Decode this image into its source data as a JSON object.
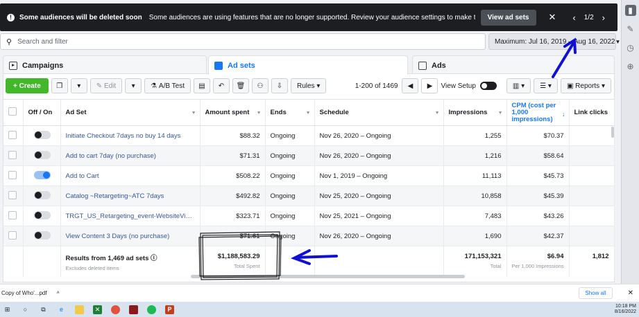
{
  "banner": {
    "title": "Some audiences will be deleted soon",
    "message": "Some audiences are using features that are no longer supported. Review your audience settings to make the necessary changes.",
    "view_button": "View ad sets",
    "pager": "1/2"
  },
  "search": {
    "placeholder": "Search and filter"
  },
  "date_range": "Maximum: Jul 16, 2019 – Aug 16, 2022",
  "tabs": [
    {
      "label": "Campaigns"
    },
    {
      "label": "Ad sets"
    },
    {
      "label": "Ads"
    }
  ],
  "toolbar": {
    "create": "Create",
    "edit": "Edit",
    "ab_test": "A/B Test",
    "rules": "Rules",
    "page_range": "1-200 of 1469",
    "view_setup": "View Setup",
    "reports": "Reports"
  },
  "columns": {
    "off_on": "Off / On",
    "ad_set": "Ad Set",
    "amount_spent": "Amount spent",
    "ends": "Ends",
    "schedule": "Schedule",
    "impressions": "Impressions",
    "cpm": "CPM (cost per 1,000 impressions)",
    "link_clicks": "Link clicks"
  },
  "rows": [
    {
      "name": "Initiate Checkout 7days no buy 14 days",
      "on": false,
      "spent": "$88.32",
      "ends": "Ongoing",
      "schedule": "Nov 26, 2020 – Ongoing",
      "impressions": "1,255",
      "cpm": "$70.37"
    },
    {
      "name": "Add to cart 7day (no purchase)",
      "on": false,
      "spent": "$71.31",
      "ends": "Ongoing",
      "schedule": "Nov 26, 2020 – Ongoing",
      "impressions": "1,216",
      "cpm": "$58.64"
    },
    {
      "name": "Add to Cart",
      "on": true,
      "spent": "$508.22",
      "ends": "Ongoing",
      "schedule": "Nov 1, 2019 – Ongoing",
      "impressions": "11,113",
      "cpm": "$45.73"
    },
    {
      "name": "Catalog ~Retargeting~ATC 7days",
      "on": false,
      "spent": "$492.82",
      "ends": "Ongoing",
      "schedule": "Nov 25, 2020 – Ongoing",
      "impressions": "10,858",
      "cpm": "$45.39"
    },
    {
      "name": "TRGT_US_Retargeting_event-WebsiteVisitors…",
      "on": false,
      "spent": "$323.71",
      "ends": "Ongoing",
      "schedule": "Nov 25, 2021 – Ongoing",
      "impressions": "7,483",
      "cpm": "$43.26"
    },
    {
      "name": "View Content 3 Days (no purchase)",
      "on": false,
      "spent": "$71.61",
      "ends": "Ongoing",
      "schedule": "Nov 26, 2020 – Ongoing",
      "impressions": "1,690",
      "cpm": "$42.37"
    }
  ],
  "totals": {
    "label": "Results from 1,469 ad sets",
    "sublabel": "Excludes deleted items",
    "spent": "$1,188,583.29",
    "spent_sub": "Total Spent",
    "impressions": "171,153,321",
    "impressions_sub": "Total",
    "cpm": "$6.94",
    "cpm_sub": "Per 1,000 Impressions",
    "link_clicks": "1,812"
  },
  "downloads": {
    "file": "Copy of Who'...pdf",
    "show_all": "Show all"
  },
  "taskbar": {
    "time": "10:18 PM",
    "date": "8/16/2022"
  },
  "colors": {
    "accent": "#1877f2",
    "create_green": "#42b72a",
    "banner_bg": "#1c1e21",
    "annotation_blue": "#1010d0"
  }
}
